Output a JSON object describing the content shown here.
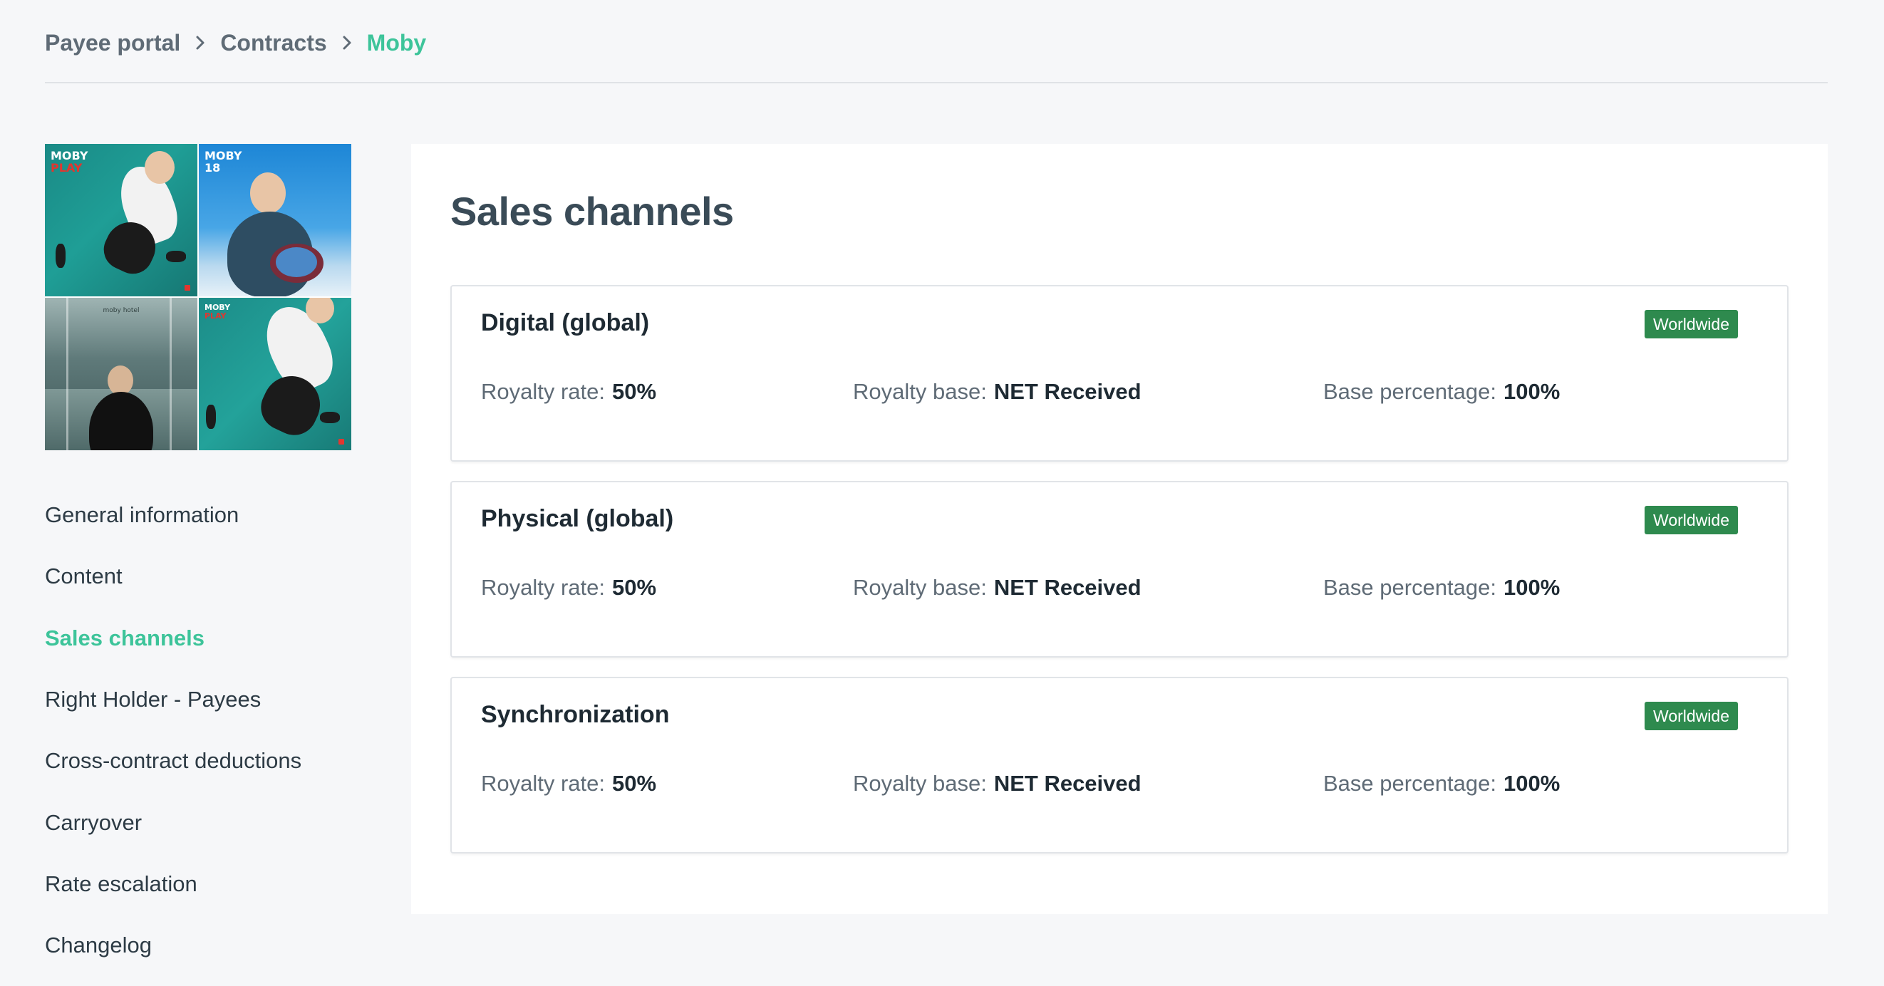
{
  "breadcrumb": {
    "items": [
      "Payee portal",
      "Contracts",
      "Moby"
    ]
  },
  "cover": {
    "tiles": [
      {
        "line1": "MOBY",
        "line2": "PLAY"
      },
      {
        "line1": "MOBY",
        "line2": "18"
      },
      {
        "line1": "moby hotel"
      },
      {
        "line1": "MOBY",
        "line2": "PLAY"
      }
    ]
  },
  "nav": {
    "items": [
      "General information",
      "Content",
      "Sales channels",
      "Right Holder - Payees",
      "Cross-contract deductions",
      "Carryover",
      "Rate escalation",
      "Changelog"
    ],
    "active": "Sales channels"
  },
  "main": {
    "title": "Sales channels",
    "channels": [
      {
        "name": "Digital (global)",
        "territory": "Worldwide",
        "royalty_rate_label": "Royalty rate:",
        "royalty_rate": "50%",
        "royalty_base_label": "Royalty base:",
        "royalty_base": "NET Received",
        "base_percentage_label": "Base percentage:",
        "base_percentage": "100%"
      },
      {
        "name": "Physical (global)",
        "territory": "Worldwide",
        "royalty_rate_label": "Royalty rate:",
        "royalty_rate": "50%",
        "royalty_base_label": "Royalty base:",
        "royalty_base": "NET Received",
        "base_percentage_label": "Base percentage:",
        "base_percentage": "100%"
      },
      {
        "name": "Synchronization",
        "territory": "Worldwide",
        "royalty_rate_label": "Royalty rate:",
        "royalty_rate": "50%",
        "royalty_base_label": "Royalty base:",
        "royalty_base": "NET Received",
        "base_percentage_label": "Base percentage:",
        "base_percentage": "100%"
      }
    ]
  },
  "colors": {
    "accent": "#3dc49a",
    "badge": "#2e8a4e",
    "background": "#f6f7f9"
  }
}
